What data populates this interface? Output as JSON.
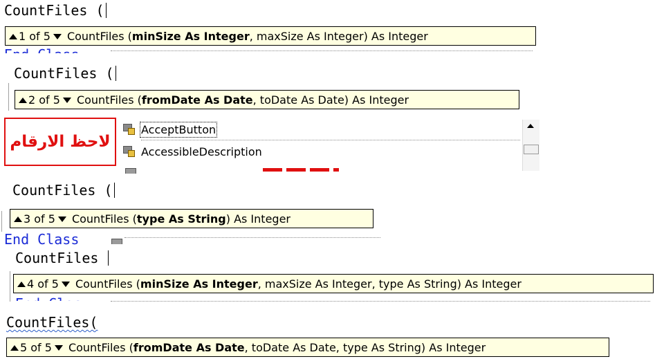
{
  "examples": [
    {
      "code": "CountFiles (",
      "tip": {
        "counter": "1 of 5",
        "name": "CountFiles (",
        "bold": "minSize As Integer",
        "rest": ", maxSize As Integer) As Integer"
      },
      "trailing": "End Class"
    },
    {
      "code": "CountFiles (",
      "tip": {
        "counter": "2 of 5",
        "name": "CountFiles (",
        "bold": "fromDate As Date",
        "rest": ", toDate As Date) As Integer"
      }
    },
    {
      "code": "CountFiles (",
      "tip": {
        "counter": "3 of 5",
        "name": "CountFiles (",
        "bold": "type As String",
        "rest": ") As Integer"
      },
      "trailing": "End Class"
    },
    {
      "code": "CountFiles",
      "tip": {
        "counter": "4 of 5",
        "name": "CountFiles (",
        "bold": "minSize As Integer",
        "rest": ", maxSize As Integer, type As String) As Integer"
      },
      "trailing": "End Clas"
    },
    {
      "code": "CountFiles(",
      "tip": {
        "counter": "5 of 5",
        "name": "CountFiles (",
        "bold": "fromDate As Date",
        "rest": ", toDate As Date, type As String) As Integer"
      }
    }
  ],
  "member_list": {
    "items": [
      "AcceptButton",
      "AccessibleDescription"
    ],
    "selected": 0,
    "icon": "property-icon"
  },
  "annotation": {
    "text": "لاحظ الارقام",
    "color": "#e01010"
  },
  "colors": {
    "tooltip_bg": "#ffffe1",
    "keyword": "#1a2bd6",
    "annotation": "#e01010"
  }
}
